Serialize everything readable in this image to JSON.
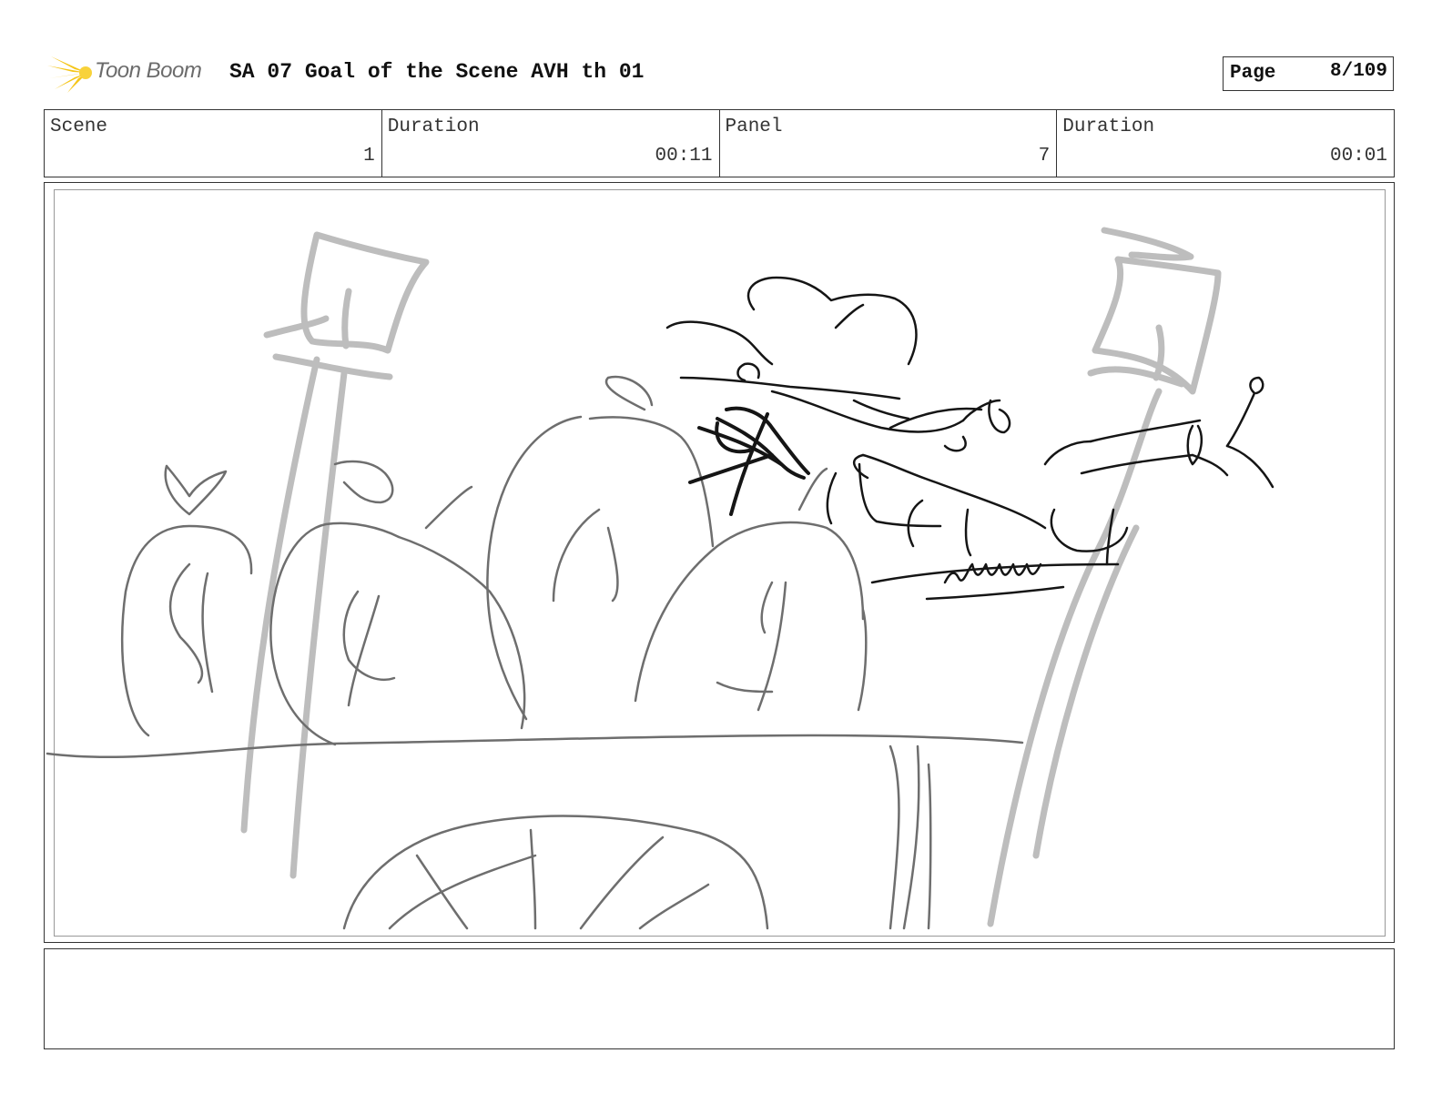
{
  "header": {
    "logo_text": "Toon Boom",
    "title": "SA 07 Goal of the Scene AVH th 01"
  },
  "page": {
    "label": "Page",
    "value": "8/109"
  },
  "info": {
    "scene": {
      "label": "Scene",
      "value": "1"
    },
    "scene_duration": {
      "label": "Duration",
      "value": "00:11"
    },
    "panel": {
      "label": "Panel",
      "value": "7"
    },
    "panel_duration": {
      "label": "Duration",
      "value": "00:01"
    }
  },
  "notes": {
    "text": ""
  },
  "colors": {
    "logo_accent": "#f5c518",
    "frame": "#333333",
    "sketch_light": "#b5b5b5",
    "sketch_mid": "#666666",
    "sketch_dark": "#111111"
  }
}
